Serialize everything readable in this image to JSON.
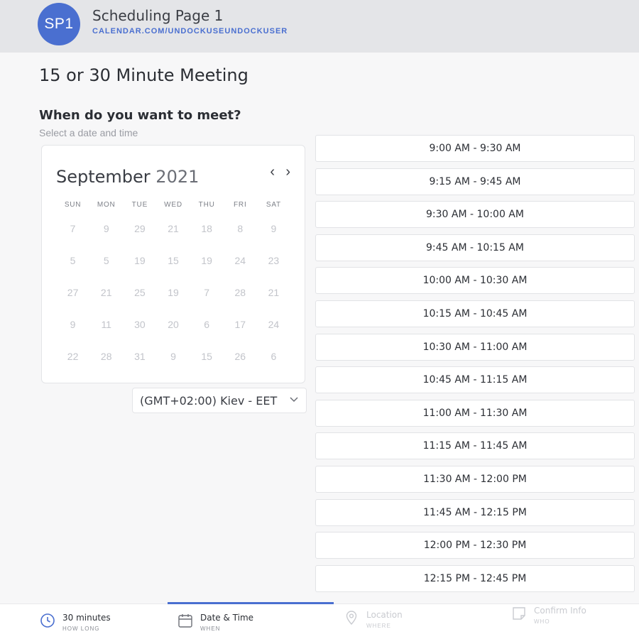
{
  "header": {
    "avatar_initials": "SP1",
    "title": "Scheduling Page 1",
    "url": "CALENDAR.COM/UNDOCKUSEUNDOCKUSER"
  },
  "meeting": {
    "title": "15 or 30 Minute Meeting",
    "question": "When do you want to meet?",
    "subtitle": "Select a date and time"
  },
  "calendar": {
    "month": "September",
    "year": "2021",
    "prev_icon": "‹",
    "next_icon": "›",
    "weekdays": [
      "SUN",
      "MON",
      "TUE",
      "WED",
      "THU",
      "FRI",
      "SAT"
    ],
    "days": [
      "7",
      "9",
      "29",
      "21",
      "18",
      "8",
      "9",
      "5",
      "5",
      "19",
      "15",
      "19",
      "24",
      "23",
      "27",
      "21",
      "25",
      "19",
      "7",
      "28",
      "21",
      "9",
      "11",
      "30",
      "20",
      "6",
      "17",
      "24",
      "22",
      "28",
      "31",
      "9",
      "15",
      "26",
      "6"
    ]
  },
  "timezone": {
    "value": "(GMT+02:00) Kiev - EET"
  },
  "slots": [
    "9:00 AM - 9:30 AM",
    "9:15 AM - 9:45 AM",
    "9:30 AM - 10:00 AM",
    "9:45 AM - 10:15 AM",
    "10:00 AM - 10:30 AM",
    "10:15 AM - 10:45 AM",
    "10:30 AM - 11:00 AM",
    "10:45 AM - 11:15 AM",
    "11:00 AM - 11:30 AM",
    "11:15 AM - 11:45 AM",
    "11:30 AM - 12:00 PM",
    "11:45 AM - 12:15 PM",
    "12:00 PM - 12:30 PM",
    "12:15 PM - 12:45 PM"
  ],
  "footer": {
    "steps": [
      {
        "label": "30 minutes",
        "sub": "HOW LONG",
        "icon": "clock-icon"
      },
      {
        "label": "Date & Time",
        "sub": "WHEN",
        "icon": "calendar-icon"
      },
      {
        "label": "Location",
        "sub": "WHERE",
        "icon": "location-pin-icon"
      },
      {
        "label": "Confirm Info",
        "sub": "WHO",
        "icon": "note-icon"
      }
    ]
  },
  "colors": {
    "accent": "#4a6fd0",
    "header_bg": "#e4e5e8"
  }
}
